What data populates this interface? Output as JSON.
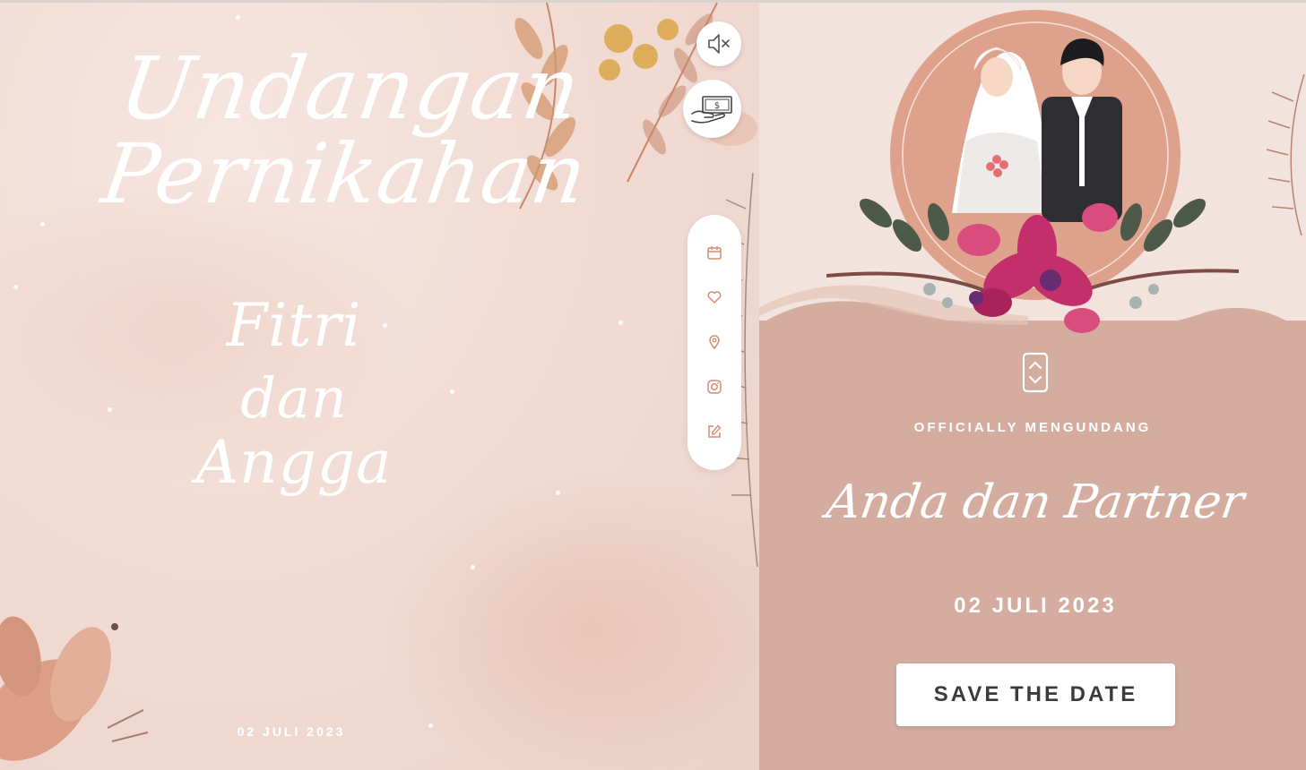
{
  "left_panel": {
    "title_line1": "Undangan",
    "title_line2": "Pernikahan",
    "bride": "Fitri",
    "conjunction": "dan",
    "groom": "Angga",
    "date": "02 JULI 2023"
  },
  "floating_controls": {
    "mute_icon": "speaker-muted-icon",
    "gift_icon": "money-gift-icon",
    "menu": [
      {
        "icon": "calendar-icon"
      },
      {
        "icon": "heart-icon"
      },
      {
        "icon": "location-pin-icon"
      },
      {
        "icon": "instagram-icon"
      },
      {
        "icon": "edit-note-icon"
      }
    ]
  },
  "right_panel": {
    "officially_text": "OFFICIALLY MENGUNDANG",
    "guest_name": "Anda dan Partner",
    "date": "02 JULI 2023",
    "save_button_label": "SAVE THE DATE",
    "scroll_icon": "scroll-updown-icon"
  },
  "colors": {
    "accent_rose": "#d5ada0",
    "circle": "#dea18b",
    "icon": "#d38d73",
    "background": "#f3e3de"
  }
}
